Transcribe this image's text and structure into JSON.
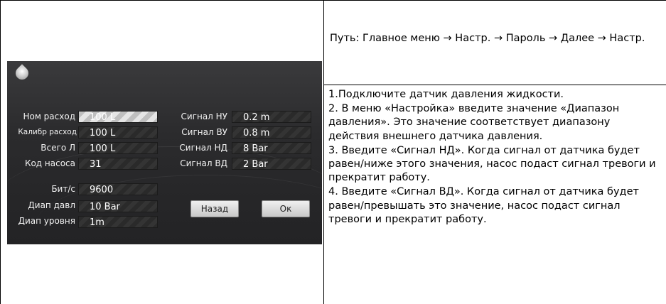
{
  "path": "Путь: Главное меню → Настр. → Пароль → Далее → Настр.",
  "instructions": [
    "1.Подключите датчик давления жидкости.",
    "2. В меню «Настройка» введите значение «Диапазон давления». Это значение соответствует диапазону действия внешнего датчика давления.",
    "3. Введите «Сигнал НД». Когда сигнал от датчика будет равен/ниже этого значения, насос подаст сигнал тревоги и прекратит работу.",
    "4. Введите «Сигнал ВД». Когда сигнал от датчика будет равен/превышать это значение, насос подаст сигнал тревоги и прекратит работу."
  ],
  "screen": {
    "icon": "water-drop-icon",
    "left": [
      {
        "label": "Ном расход",
        "value": "100 L"
      },
      {
        "label": "Калибр расход",
        "value": "100 L"
      },
      {
        "label": "Всего  Л",
        "value": "100 L"
      },
      {
        "label": "Код насоса",
        "value": "31"
      },
      {
        "label": "Бит/с",
        "value": "9600"
      },
      {
        "label": "Диап давл",
        "value": "10 Bar"
      },
      {
        "label": "Диап уровня",
        "value": "1m"
      }
    ],
    "right": [
      {
        "label": "Сигнал НУ",
        "value": "0.2 m"
      },
      {
        "label": "Сигнал ВУ",
        "value": "0.8 m"
      },
      {
        "label": "Сигнал НД",
        "value": "8 Bar"
      },
      {
        "label": "Сигнал ВД",
        "value": "2 Bar"
      }
    ],
    "back_label": "Назад",
    "ok_label": "Ок"
  }
}
